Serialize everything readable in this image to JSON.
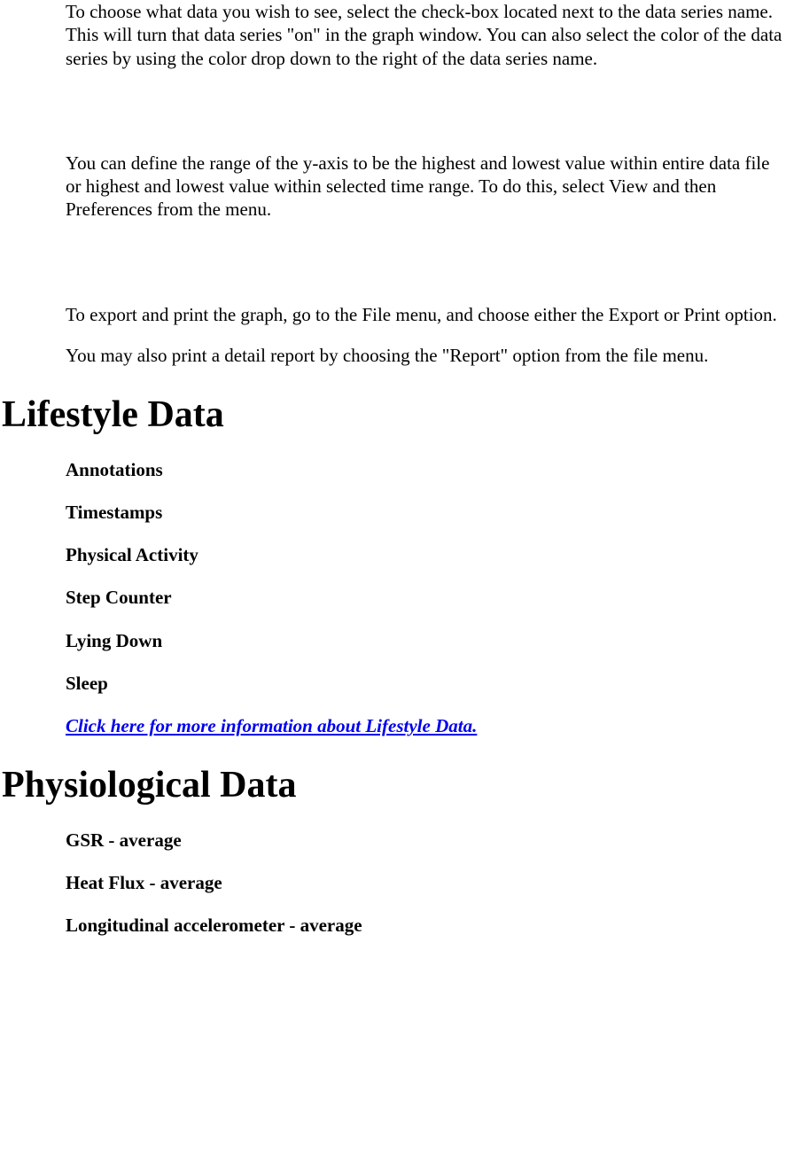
{
  "intro": {
    "p1": "To choose what data you wish to see, select the check-box located next to the data series name. This will turn that data series \"on\" in the graph window. You can also select the color of the data series by using the color drop down to the right of the data series name.",
    "p2": "You can define the range of the y-axis to be the highest and lowest value within entire data file or highest and lowest value within selected time range. To do this, select View and then Preferences from the menu.",
    "p3": "To export and print the graph, go to the File menu, and choose either the Export or Print option.",
    "p4": "You may also print a detail report by choosing the \"Report\" option from the file menu."
  },
  "lifestyle": {
    "heading": "Lifestyle Data",
    "items": [
      "Annotations",
      "Timestamps",
      "Physical Activity",
      "Step Counter",
      "Lying Down",
      "Sleep"
    ],
    "link_text": "Click here for more information about Lifestyle Data."
  },
  "physio": {
    "heading": "Physiological Data",
    "items": [
      "GSR - average",
      "Heat Flux - average",
      "Longitudinal accelerometer - average"
    ]
  }
}
